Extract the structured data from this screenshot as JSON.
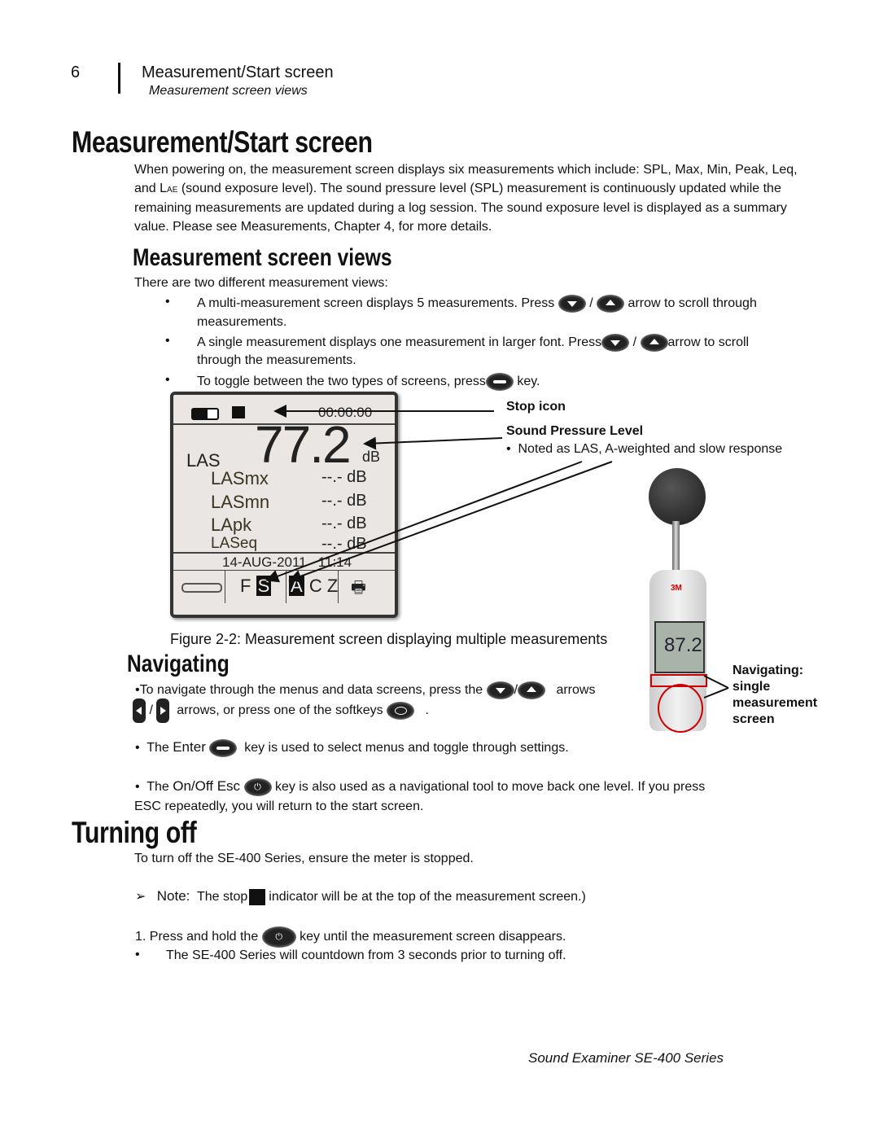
{
  "header": {
    "page_number": "6",
    "section": "Measurement/Start screen",
    "subsection": "Measurement screen views"
  },
  "intro": {
    "title": "Measurement/Start screen",
    "lines": [
      "When powering on, the measurement screen displays six measurements which include:  SPL, Max, Min, Peak, Leq,",
      "and L",
      "AE",
      " (sound exposure level). The sound pressure level (SPL) measurement is continuously updated while the",
      "remaining measurements are updated during a log session.  The sound exposure level is displayed as a summary",
      "value.  Please see Measurements, Chapter 4, for more details."
    ]
  },
  "views": {
    "title": "Measurement screen views",
    "lead": "There are two different measurement views:",
    "b1a": "A multi-measurement screen displays 5 measurements.  Press",
    "b1b": "arrow to scroll through",
    "b1c": "measurements.",
    "b2a": "A single measurement displays one measurement in larger font.  Press",
    "b2b": "arrow to scroll",
    "b2c": "through the measurements.",
    "b3a": "To toggle between the two types of screens, press",
    "b3b": "key.",
    "slash": "/"
  },
  "lcd": {
    "timer": "00:00:00",
    "main_value": "77.2",
    "unit": "dB",
    "main_label": "LAS",
    "rows": [
      {
        "label": "LASmx",
        "value": "--.- dB"
      },
      {
        "label": "LASmn",
        "value": "--.- dB"
      },
      {
        "label": "LApk",
        "value": "--.- dB"
      },
      {
        "label": "LASeq",
        "value": "--.- dB"
      }
    ],
    "datetime": "14-AUG-2011   11:14",
    "resp_f": "F",
    "resp_s": "S",
    "weight_a": "A",
    "weight_c": "C",
    "weight_z": "Z"
  },
  "callouts": {
    "stop": "Stop icon",
    "spl": "Sound Pressure Level",
    "spl_note": "Noted as LAS, A-weighted and slow response"
  },
  "figure_caption": "Figure 2-2: Measurement screen displaying multiple measurements",
  "meter": {
    "brand": "3M",
    "display_value": "87.2",
    "callout": [
      "Navigating:",
      "single",
      "measurement",
      "screen"
    ]
  },
  "navigating": {
    "title": "Navigating",
    "l1a": "•To navigate through the menus and data screens, press the",
    "l1b": "arrows",
    "l2a": "arrows, or press one of the softkeys",
    "l2b": ".",
    "enter_a": "The ",
    "enter_b": "Enter",
    "enter_c": "key is used to select menus and toggle through settings.",
    "esc_a": "The ",
    "esc_b": "On/Off Esc",
    "esc_c": "key is also used as a navigational tool to move back one level.  If you press",
    "esc_d": "ESC repeatedly, you will return to the start screen."
  },
  "turning_off": {
    "title": "Turning off",
    "lead": "To turn off the SE-400 Series, ensure the meter is stopped.",
    "note_label": "Note:",
    "note_a": "The stop",
    "note_b": "indicator will be at the top of the measurement screen.)",
    "step1a": "1.  Press and hold the",
    "step1b": "key until the measurement screen disappears.",
    "bullet": "The SE-400 Series will countdown from 3 seconds prior to turning off."
  },
  "footer": "Sound Examiner SE-400 Series"
}
